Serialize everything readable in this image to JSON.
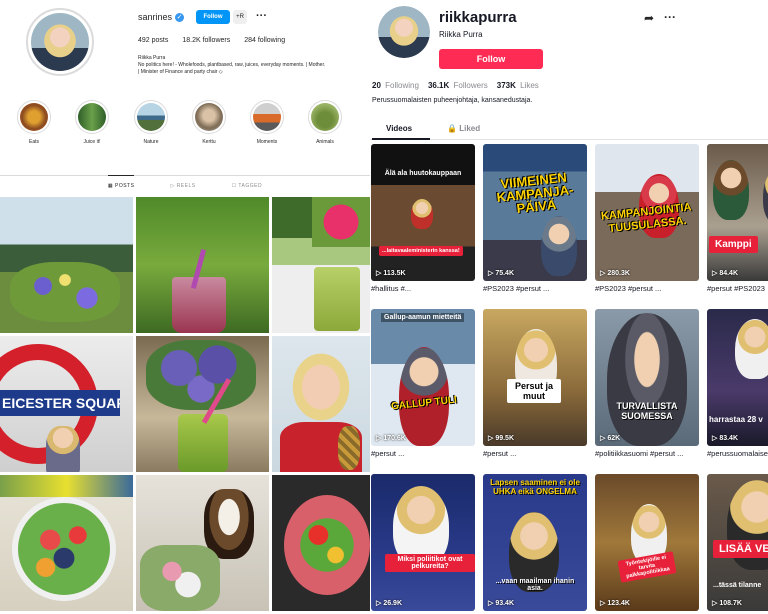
{
  "instagram": {
    "username": "sanrines",
    "follow_label": "Follow",
    "add_label": "+R",
    "stats": {
      "posts": "492 posts",
      "followers": "18.2K followers",
      "following": "284 following"
    },
    "bio": {
      "name": "Riikka Purra",
      "line1": "No politics here! - Wholefoods, plantbased, raw, juices, everyday moments. | Mother.",
      "line2": "| Minister of Finance and party chair ◇"
    },
    "highlights": [
      "Eats",
      "Juice it!",
      "Nature",
      "Kerttu",
      "Moments",
      "Animals"
    ],
    "tabs": [
      "POSTS",
      "REELS",
      "TAGGED"
    ],
    "post_sign_text": "EICESTER SQUARE"
  },
  "tiktok": {
    "username": "riikkapurra",
    "display_name": "Riikka Purra",
    "follow_label": "Follow",
    "stats": {
      "following_n": "20",
      "following_l": "Following",
      "followers_n": "36.1K",
      "followers_l": "Followers",
      "likes_n": "373K",
      "likes_l": "Likes"
    },
    "bio": "Perussuomalaisten puheenjohtaja, kansanedustaja.",
    "tabs": {
      "videos": "Videos",
      "liked": "Liked"
    },
    "videos": [
      {
        "views": "113.5K",
        "caption": "#hallitus #...",
        "t1": "Älä ala huutokauppaan",
        "t2": "...laitavaaleministerin kanssa!"
      },
      {
        "views": "75.4K",
        "caption": "#PS2023 #persut ...",
        "t1": "VIIMEINEN KAMPANJA-PÄIVÄ"
      },
      {
        "views": "280.3K",
        "caption": "#PS2023 #persut ...",
        "t1": "KAMPANJOINTIA TUUSULASSA."
      },
      {
        "views": "84.4K",
        "caption": "#persut #PS2023",
        "t1": "Kamppi"
      },
      {
        "views": "170.6K",
        "caption": "#persut ...",
        "t1": "Gallup-aamun mietteitä",
        "t2": "GALLUP TULI"
      },
      {
        "views": "99.5K",
        "caption": "#persut ...",
        "t1": "Persut ja muut"
      },
      {
        "views": "62K",
        "caption": "#politiikkasuomi #persut ...",
        "t1": "TURVALLISTA SUOMESSA"
      },
      {
        "views": "83.4K",
        "caption": "#perussuomalaiset...",
        "t1": "harrastaa 28 v"
      },
      {
        "views": "26.9K",
        "caption": "",
        "t1": "Miksi poliitikot ovat pelkureita?"
      },
      {
        "views": "93.4K",
        "caption": "",
        "t1": "Lapsen saaminen ei ole UHKA eikä ONGELMA",
        "t2": "...vaan maailman ihanin asia."
      },
      {
        "views": "123.4K",
        "caption": "",
        "t1": "Työntekijöille ei tarvita palkkapolitiikkaa"
      },
      {
        "views": "108.7K",
        "caption": "",
        "t1": "LISÄÄ VER",
        "t2": "...tässä tilanne"
      }
    ]
  }
}
